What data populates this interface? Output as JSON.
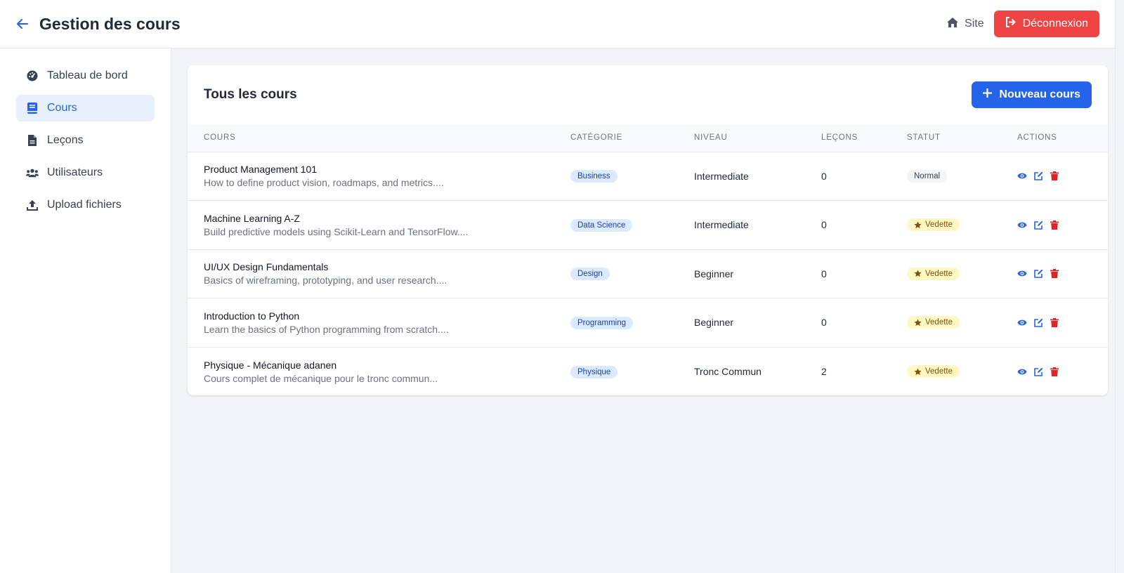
{
  "header": {
    "title": "Gestion des cours",
    "site_label": "Site",
    "logout_label": "Déconnexion"
  },
  "sidebar": {
    "items": [
      {
        "label": "Tableau de bord",
        "icon": "dashboard-icon",
        "active": false
      },
      {
        "label": "Cours",
        "icon": "book-icon",
        "active": true
      },
      {
        "label": "Leçons",
        "icon": "file-icon",
        "active": false
      },
      {
        "label": "Utilisateurs",
        "icon": "users-icon",
        "active": false
      },
      {
        "label": "Upload fichiers",
        "icon": "upload-icon",
        "active": false
      }
    ]
  },
  "main": {
    "card_title": "Tous les cours",
    "new_course_label": "Nouveau cours",
    "columns": [
      "COURS",
      "CATÉGORIE",
      "NIVEAU",
      "LEÇONS",
      "STATUT",
      "ACTIONS"
    ],
    "rows": [
      {
        "title": "Product Management 101",
        "desc": "How to define product vision, roadmaps, and metrics....",
        "category": "Business",
        "level": "Intermediate",
        "lessons": "0",
        "status": "Normal"
      },
      {
        "title": "Machine Learning A-Z",
        "desc": "Build predictive models using Scikit-Learn and TensorFlow....",
        "category": "Data Science",
        "level": "Intermediate",
        "lessons": "0",
        "status": "Vedette"
      },
      {
        "title": "UI/UX Design Fundamentals",
        "desc": "Basics of wireframing, prototyping, and user research....",
        "category": "Design",
        "level": "Beginner",
        "lessons": "0",
        "status": "Vedette"
      },
      {
        "title": "Introduction to Python",
        "desc": "Learn the basics of Python programming from scratch....",
        "category": "Programming",
        "level": "Beginner",
        "lessons": "0",
        "status": "Vedette"
      },
      {
        "title": "Physique - Mécanique adanen",
        "desc": "Cours complet de mécanique pour le tronc commun...",
        "category": "Physique",
        "level": "Tronc Commun",
        "lessons": "2",
        "status": "Vedette"
      }
    ]
  },
  "colors": {
    "primary": "#2563eb",
    "danger": "#ef4444",
    "featured_bg": "#fef9c3",
    "featured_text": "#854d0e",
    "category_bg": "#dbeafe"
  }
}
